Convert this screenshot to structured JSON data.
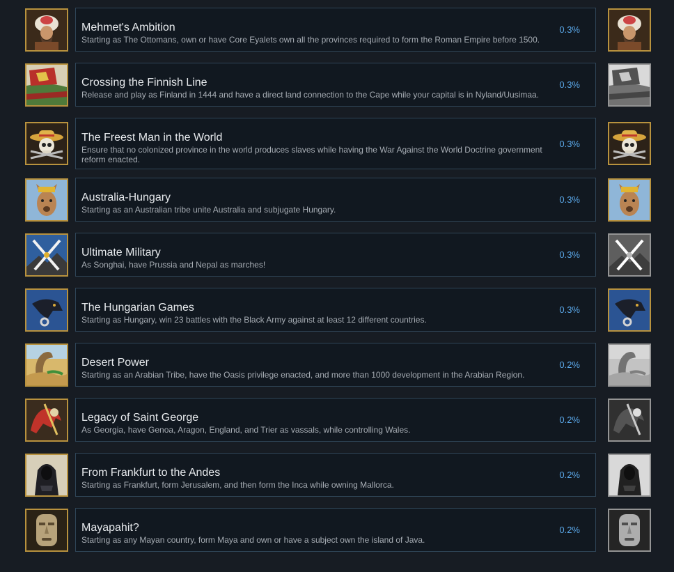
{
  "achievements": [
    {
      "title": "Mehmet's Ambition",
      "description": "Starting as The Ottomans, own or have Core Eyalets own all the provinces required to form the Roman Empire before 1500.",
      "percent": "0.3%",
      "icon": "sultan-portrait-icon",
      "right_icon_gray": false
    },
    {
      "title": "Crossing the Finnish Line",
      "description": "Release and play as Finland in 1444 and have a direct land connection to the Cape while your capital is in Nyland/Uusimaa.",
      "percent": "0.3%",
      "icon": "finnish-lion-flag-icon",
      "right_icon_gray": true
    },
    {
      "title": "The Freest Man in the World",
      "description": "Ensure that no colonized province in the world produces slaves while having the War Against the World Doctrine government reform enacted.",
      "percent": "0.3%",
      "icon": "straw-hat-skull-icon",
      "right_icon_gray": false
    },
    {
      "title": "Australia-Hungary",
      "description": "Starting as an Australian tribe unite Australia and subjugate Hungary.",
      "percent": "0.3%",
      "icon": "crowned-kangaroo-icon",
      "right_icon_gray": false
    },
    {
      "title": "Ultimate Military",
      "description": "As Songhai, have Prussia and Nepal as marches!",
      "percent": "0.3%",
      "icon": "crossed-swords-icon",
      "right_icon_gray": true
    },
    {
      "title": "The Hungarian Games",
      "description": "Starting as Hungary, win 23 battles with the Black Army against at least 12 different countries.",
      "percent": "0.3%",
      "icon": "raven-ring-icon",
      "right_icon_gray": false
    },
    {
      "title": "Desert Power",
      "description": "Starting as an Arabian Tribe, have the Oasis privilege enacted, and more than 1000 development in the Arabian Region.",
      "percent": "0.2%",
      "icon": "sandworm-desert-icon",
      "right_icon_gray": true
    },
    {
      "title": "Legacy of Saint George",
      "description": "As Georgia, have Genoa, Aragon, England, and Trier as vassals, while controlling Wales.",
      "percent": "0.2%",
      "icon": "dragon-knight-icon",
      "right_icon_gray": true
    },
    {
      "title": "From Frankfurt to the Andes",
      "description": "Starting as Frankfurt, form Jerusalem, and then form the Inca while owning Mallorca.",
      "percent": "0.2%",
      "icon": "hooded-figure-icon",
      "right_icon_gray": true
    },
    {
      "title": "Mayapahit?",
      "description": "Starting as any Mayan country, form Maya and own or have a subject own the island of Java.",
      "percent": "0.2%",
      "icon": "stone-mask-icon",
      "right_icon_gray": true
    }
  ]
}
